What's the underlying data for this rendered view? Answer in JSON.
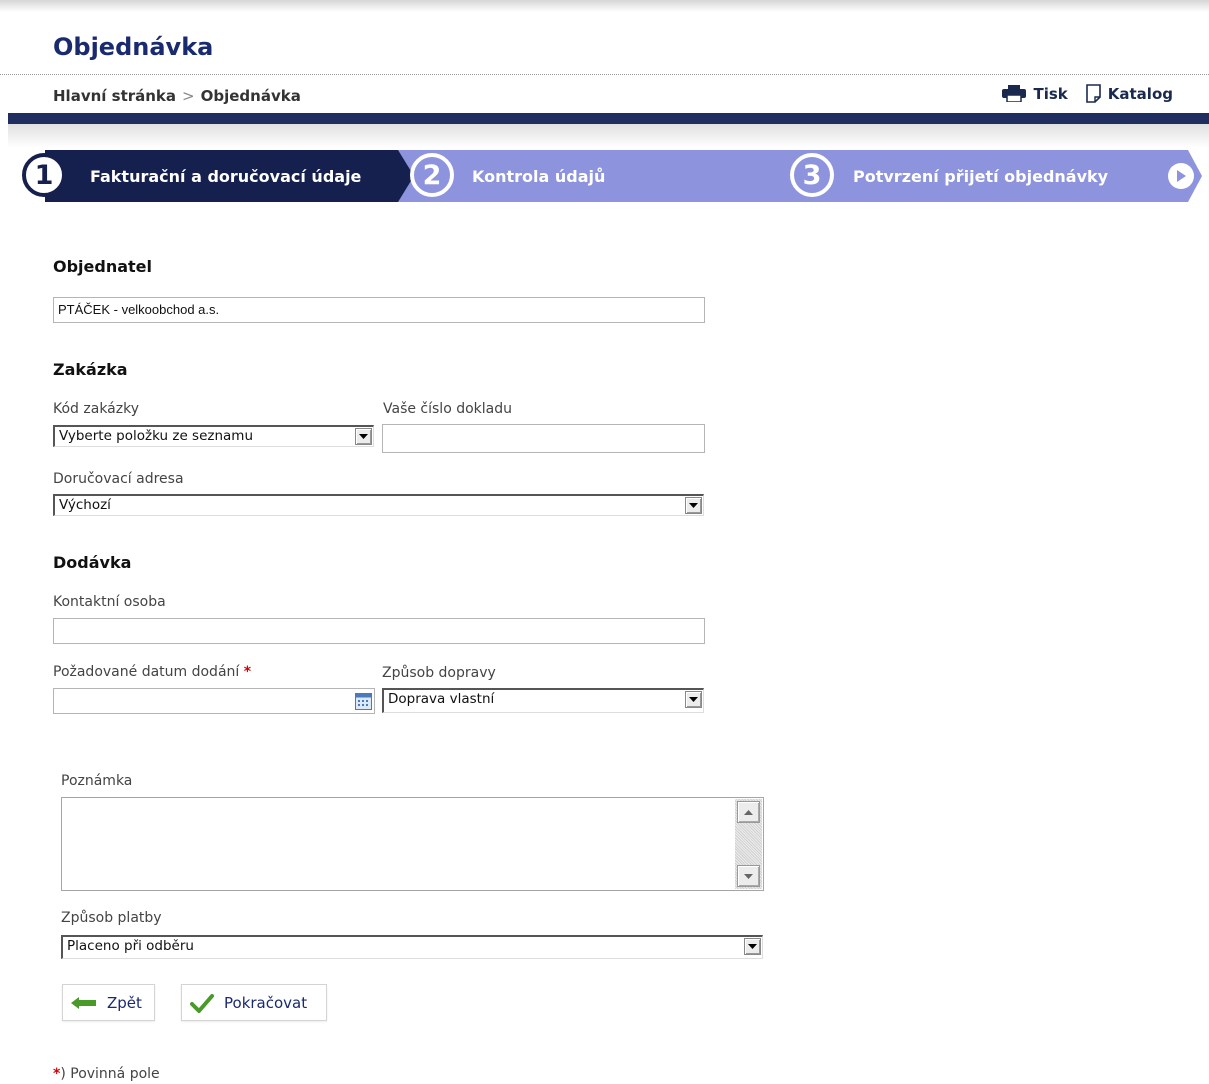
{
  "page": {
    "title": "Objednávka"
  },
  "breadcrumb": {
    "home": "Hlavní stránka",
    "separator": ">",
    "current": "Objednávka"
  },
  "toplinks": {
    "print_label": "Tisk",
    "print_icon": "printer-icon",
    "catalog_label": "Katalog",
    "catalog_icon": "document-icon"
  },
  "steps": [
    {
      "number": "1",
      "label": "Fakturační a doručovací údaje",
      "state": "active"
    },
    {
      "number": "2",
      "label": "Kontrola údajů",
      "state": "inactive"
    },
    {
      "number": "3",
      "label": "Potvrzení přijetí objednávky",
      "state": "inactive"
    }
  ],
  "colors": {
    "navy": "#1f2e5f",
    "step_inactive": "#8d93dd",
    "required": "#d40000",
    "ok_green": "#4a9a2a"
  },
  "orderer": {
    "heading": "Objednatel",
    "value": "PTÁČEK - velkoobchod a.s."
  },
  "contract": {
    "heading": "Zakázka",
    "code_label": "Kód zakázky",
    "code_value": "Vyberte položku ze seznamu",
    "doc_number_label": "Vaše číslo dokladu",
    "doc_number_value": "",
    "address_label": "Doručovací adresa",
    "address_value": "Výchozí"
  },
  "delivery": {
    "heading": "Dodávka",
    "contact_label": "Kontaktní osoba",
    "contact_value": "",
    "date_label": "Požadované datum dodání",
    "required_mark": "*",
    "date_value": "",
    "transport_label": "Způsob dopravy",
    "transport_value": "Doprava vlastní"
  },
  "note": {
    "label": "Poznámka",
    "value": ""
  },
  "payment": {
    "label": "Způsob platby",
    "value": "Placeno při odběru"
  },
  "buttons": {
    "back_label": "Zpět",
    "continue_label": "Pokračovat"
  },
  "footnote": {
    "mark": "*",
    "paren": ")",
    "text": "Povinná pole"
  }
}
